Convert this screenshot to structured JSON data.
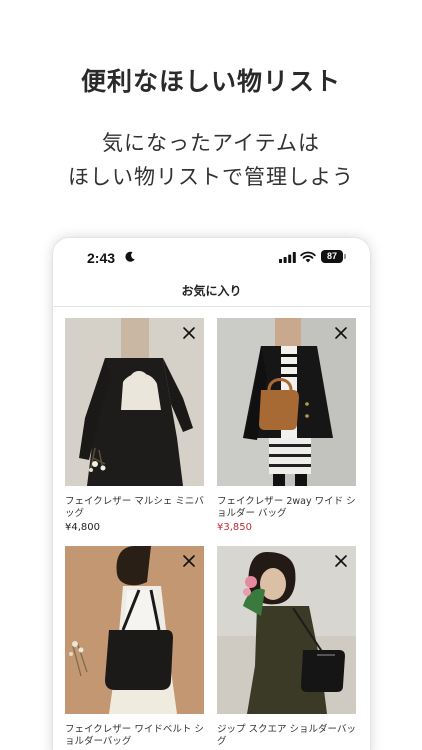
{
  "promo": {
    "headline": "便利なほしい物リスト",
    "subtext_line1": "気になったアイテムは",
    "subtext_line2": "ほしい物リストで管理しよう"
  },
  "status_bar": {
    "time": "2:43",
    "battery": "87",
    "icons": [
      "moon-icon",
      "cellular-signal-icon",
      "wifi-icon",
      "battery-icon"
    ]
  },
  "nav": {
    "title": "お気に入り"
  },
  "favorites": [
    {
      "name": "フェイクレザー マルシェ ミニバッグ",
      "price": "¥4,800",
      "sale": false
    },
    {
      "name": "フェイクレザー 2way ワイド ショルダー バッグ",
      "price": "¥3,850",
      "sale": true
    },
    {
      "name": "フェイクレザー ワイドベルト ショルダーバッグ",
      "price": "",
      "sale": false
    },
    {
      "name": "ジップ スクエア ショルダーバッグ",
      "price": "",
      "sale": false
    }
  ],
  "colors": {
    "sale_price": "#c0303a",
    "text": "#222222"
  }
}
